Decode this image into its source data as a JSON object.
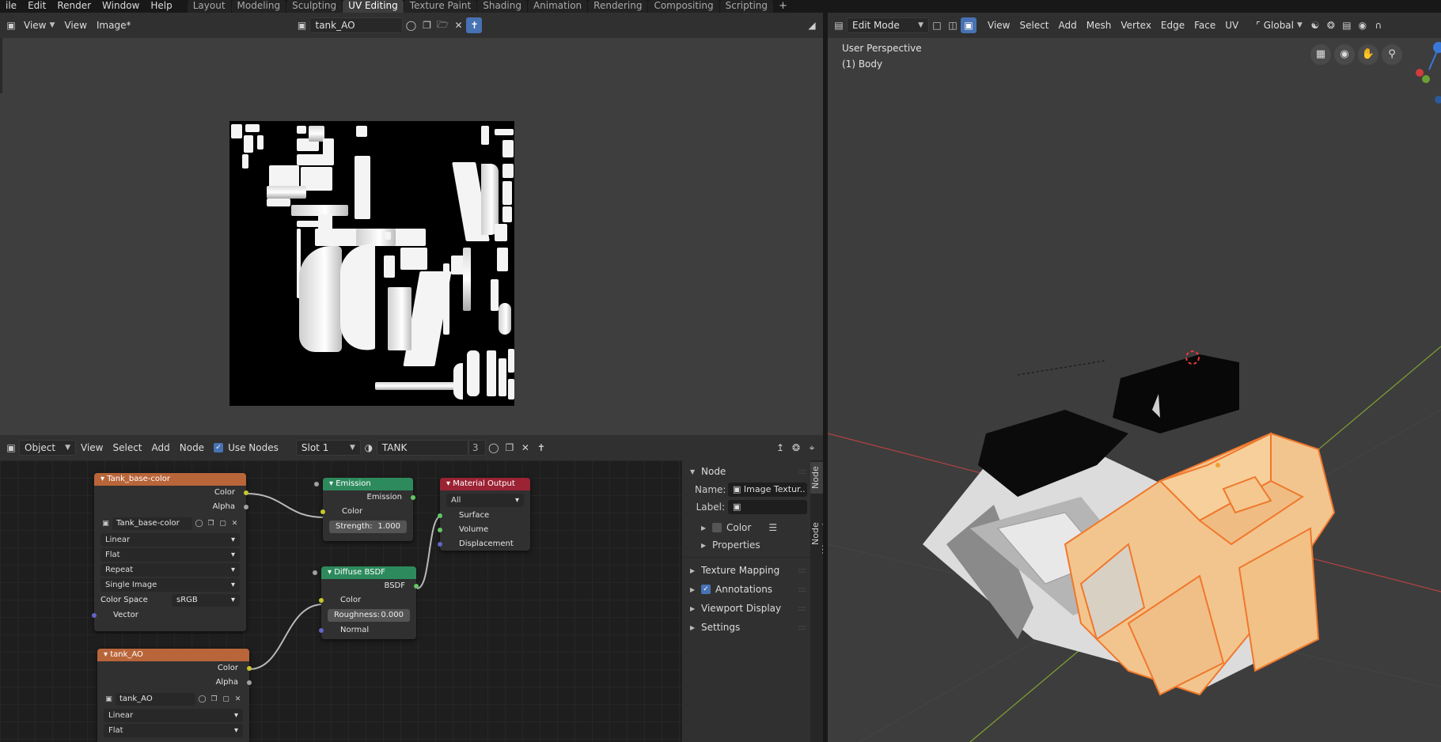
{
  "topbar": {
    "menus": [
      "ile",
      "Edit",
      "Render",
      "Window",
      "Help"
    ],
    "workspaces": [
      "Layout",
      "Modeling",
      "Sculpting",
      "UV Editing",
      "Texture Paint",
      "Shading",
      "Animation",
      "Rendering",
      "Compositing",
      "Scripting"
    ],
    "active_workspace": "UV Editing",
    "add_tab": "+"
  },
  "uv_header": {
    "mode": "View",
    "menus": [
      "View",
      "Image*"
    ],
    "image_name": "tank_AO"
  },
  "viewport_header": {
    "mode": "Edit Mode",
    "menus": [
      "View",
      "Select",
      "Add",
      "Mesh",
      "Vertex",
      "Edge",
      "Face",
      "UV"
    ],
    "orientation": "Global"
  },
  "viewport": {
    "perspective_label": "User Perspective",
    "object_label": "(1) Body",
    "colors": {
      "selection": "#f0782c",
      "face_select": "#f3c58e",
      "grid_x": "#b34242",
      "grid_y": "#7fa332"
    }
  },
  "node_header": {
    "object_mode": "Object",
    "menus": [
      "View",
      "Select",
      "Add",
      "Node"
    ],
    "use_nodes_label": "Use Nodes",
    "use_nodes_checked": true,
    "slot": "Slot 1",
    "material_name": "TANK",
    "user_count": "3"
  },
  "nodes": {
    "tex1": {
      "title": "Tank_base-color",
      "out_color": "Color",
      "out_alpha": "Alpha",
      "image": "Tank_base-color",
      "interpolation": "Linear",
      "projection": "Flat",
      "extension": "Repeat",
      "source": "Single Image",
      "color_space_label": "Color Space",
      "color_space": "sRGB",
      "in_vector": "Vector"
    },
    "tex2": {
      "title": "tank_AO",
      "out_color": "Color",
      "out_alpha": "Alpha",
      "image": "tank_AO",
      "interpolation": "Linear",
      "projection": "Flat"
    },
    "emission": {
      "title": "Emission",
      "out": "Emission",
      "in_color": "Color",
      "strength_label": "Strength:",
      "strength": "1.000"
    },
    "diffuse": {
      "title": "Diffuse BSDF",
      "out": "BSDF",
      "in_color": "Color",
      "roughness_label": "Roughness:",
      "roughness": "0.000",
      "in_normal": "Normal"
    },
    "output": {
      "title": "Material Output",
      "target": "All",
      "in_surface": "Surface",
      "in_volume": "Volume",
      "in_displacement": "Displacement"
    }
  },
  "npanel": {
    "section_node": "Node",
    "name_label": "Name:",
    "name_value": "Image Textur..",
    "label_label": "Label:",
    "color_label": "Color",
    "properties_label": "Properties",
    "sections": [
      "Texture Mapping",
      "Annotations",
      "Viewport Display",
      "Settings"
    ],
    "annotations_checked": true,
    "tabs": [
      "Node",
      "Node Wrangler"
    ]
  }
}
